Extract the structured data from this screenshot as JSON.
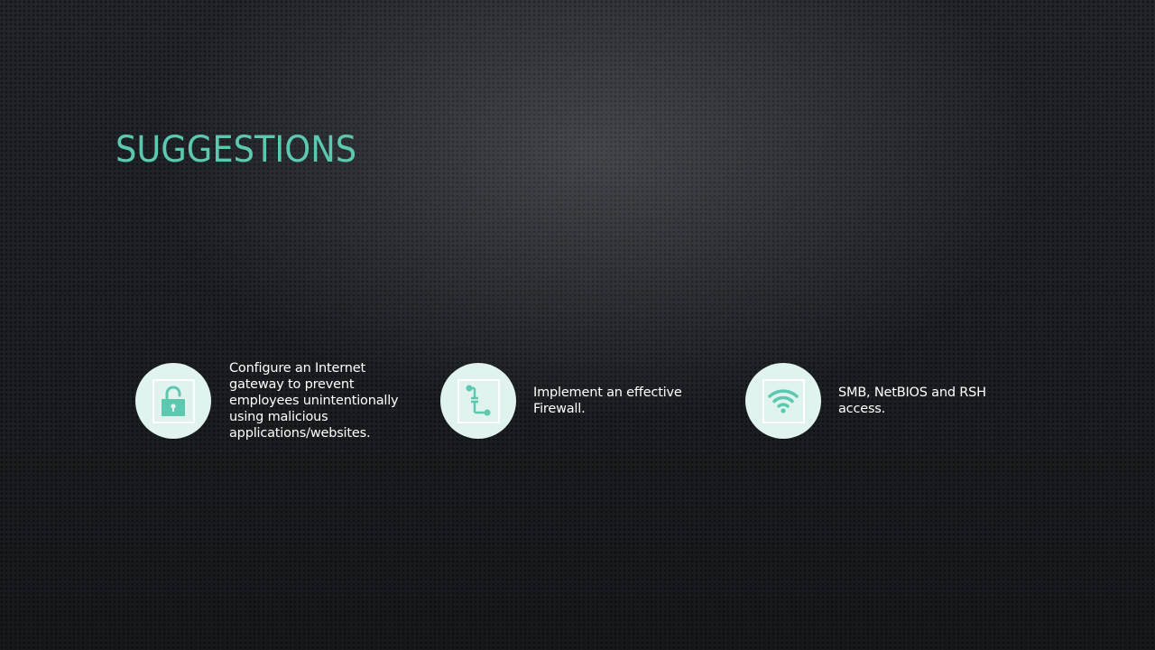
{
  "slide": {
    "title": "Suggestions"
  },
  "items": [
    {
      "icon": "unlocked-padlock-icon",
      "text": "Configure an Internet gateway to prevent employees unintentionally using malicious applications/websites."
    },
    {
      "icon": "flowchart-path-icon",
      "text": "Implement an effective Firewall."
    },
    {
      "icon": "wifi-signal-icon",
      "text": "SMB, NetBIOS and RSH access."
    }
  ],
  "colors": {
    "accent": "#5cc8b0",
    "circle_fill": "#e0f3ee",
    "text": "#ffffff",
    "background": "#22262b"
  }
}
